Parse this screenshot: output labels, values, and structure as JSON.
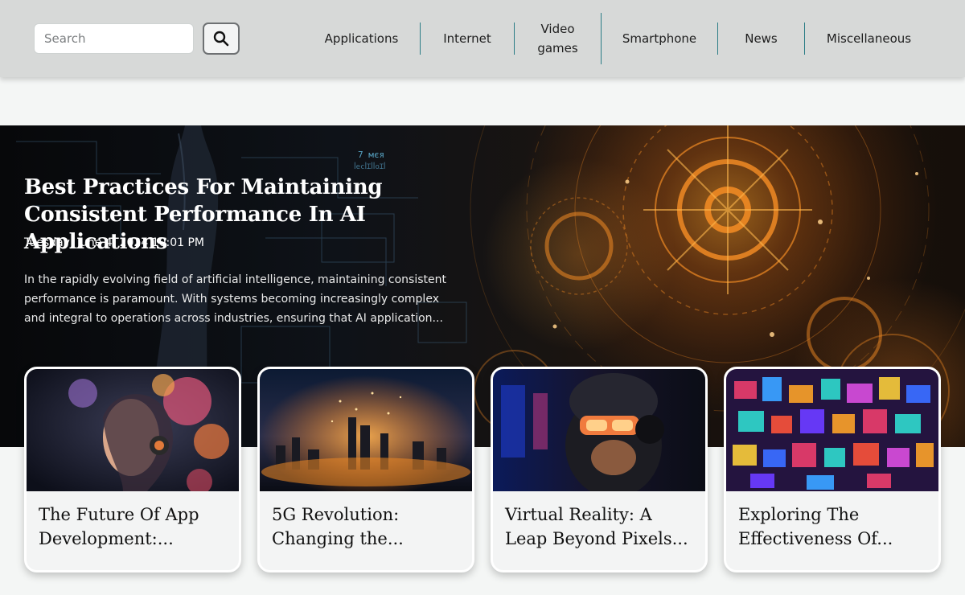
{
  "search": {
    "placeholder": "Search"
  },
  "nav": {
    "items": [
      {
        "label": "Applications"
      },
      {
        "label": "Internet"
      },
      {
        "label": "Video games"
      },
      {
        "label": "Smartphone"
      },
      {
        "label": "News"
      },
      {
        "label": "Miscellaneous"
      }
    ]
  },
  "hero": {
    "title": "Best Practices For Maintaining Consistent Performance In AI Applications",
    "date": "Tuesday, June 4, 2024 10:01 PM",
    "excerpt": "In the rapidly evolving field of artificial intelligence, maintaining consistent performance is paramount. With systems becoming increasingly complex and integral to operations across industries, ensuring that AI application...",
    "art_text": [
      "7 мєя",
      "ꟾecꟾꞮꟾꟾoꞮꟾ"
    ]
  },
  "cards": [
    {
      "title": "The Future Of App Development:..."
    },
    {
      "title": "5G Revolution: Changing the..."
    },
    {
      "title": "Virtual Reality: A Leap Beyond Pixels..."
    },
    {
      "title": "Exploring The Effectiveness Of..."
    }
  ],
  "colors": {
    "header_bg": "#d7d9d8",
    "nav_separator": "#2b7d86",
    "page_bg": "#f4f6f5",
    "hero_accent": "#f08a24"
  }
}
